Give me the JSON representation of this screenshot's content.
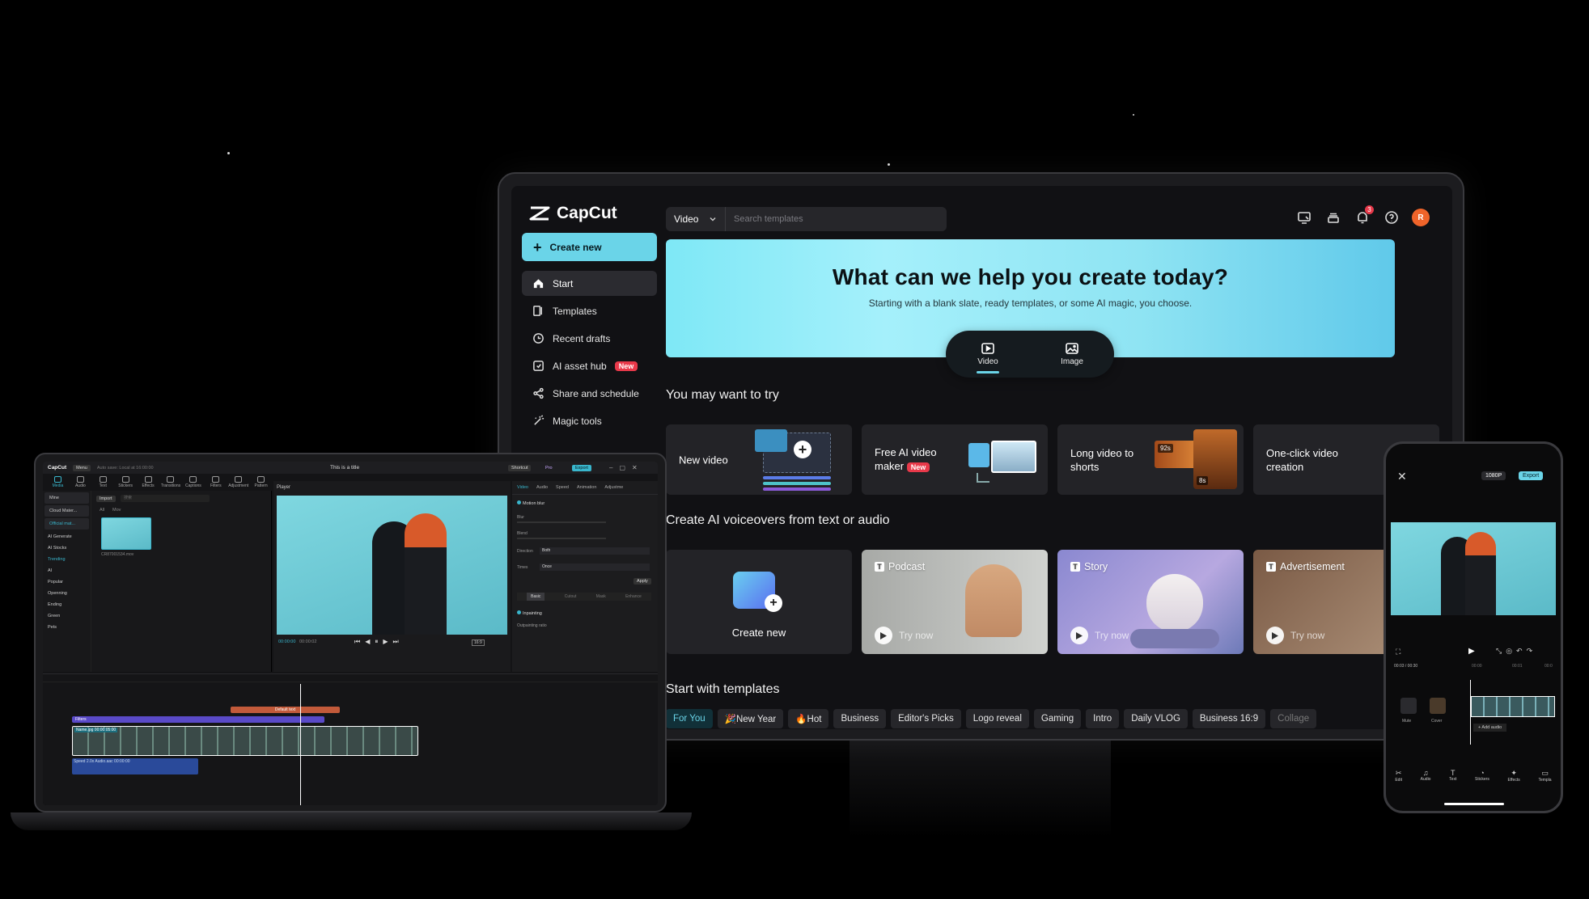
{
  "app": {
    "name": "CapCut",
    "create_new": "Create new"
  },
  "sidebar": {
    "items": [
      {
        "label": "Start",
        "icon": "home-icon",
        "active": true
      },
      {
        "label": "Templates",
        "icon": "templates-icon"
      },
      {
        "label": "Recent drafts",
        "icon": "clock-icon"
      },
      {
        "label": "AI asset hub",
        "icon": "ai-asset-icon",
        "badge": "New"
      },
      {
        "label": "Share and schedule",
        "icon": "share-icon"
      },
      {
        "label": "Magic tools",
        "icon": "magic-wand-icon"
      }
    ]
  },
  "search": {
    "type": "Video",
    "placeholder": "Search templates"
  },
  "header": {
    "notification_count": "3",
    "avatar_initial": "R"
  },
  "hero": {
    "title": "What can we help you create today?",
    "subtitle": "Starting with a blank slate, ready templates, or some AI magic, you choose.",
    "tabs": [
      {
        "label": "Video",
        "icon": "video-icon",
        "active": true
      },
      {
        "label": "Image",
        "icon": "image-icon"
      }
    ]
  },
  "try_section": {
    "title": "You may want to try",
    "cards": [
      {
        "label": "New video"
      },
      {
        "label": "Free AI video maker",
        "badge": "New"
      },
      {
        "label": "Long video to shorts",
        "tag1": "92s",
        "tag2": "8s"
      },
      {
        "label": "One-click video creation"
      }
    ]
  },
  "voiceover_section": {
    "title": "Create AI voiceovers from text or audio",
    "cards": [
      {
        "label": "Create new"
      },
      {
        "label": "Podcast",
        "action": "Try now"
      },
      {
        "label": "Story",
        "action": "Try now"
      },
      {
        "label": "Advertisement",
        "action": "Try now"
      }
    ]
  },
  "templates_section": {
    "title": "Start with templates",
    "chips": [
      "For You",
      "🎉New Year",
      "🔥Hot",
      "Business",
      "Editor's Picks",
      "Logo reveal",
      "Gaming",
      "Intro",
      "Daily VLOG",
      "Business 16:9",
      "Collage"
    ]
  },
  "laptop": {
    "logo": "CapCut",
    "menu": "Menu",
    "autosave": "Auto save: Local at 16:00:00",
    "title": "This is a title",
    "shortcut": "Shortcut",
    "pro": "Pro",
    "export": "Export",
    "tools": [
      "Media",
      "Audio",
      "Text",
      "Stickers",
      "Effects",
      "Transitions",
      "Captions",
      "Filters",
      "Adjustment",
      "Pattern"
    ],
    "media_side": [
      "Mine",
      "Cloud Mater...",
      "Official mat...",
      "AI Generate",
      "AI Stocks",
      "Trending",
      "AI",
      "Popular",
      "Openning",
      "Ending",
      "Green",
      "Pets"
    ],
    "import": "Import",
    "search_hint": "搜索",
    "filter_all": "All",
    "filter_mov": "Mov",
    "file_name": "CR87001534.mov",
    "player_label": "Player",
    "time_current": "00:00:00",
    "time_total": "00:00:02",
    "ratio": "16:9",
    "prop_tabs": [
      "Video",
      "Audio",
      "Speed",
      "Animation",
      "Adjustme"
    ],
    "motion_blur": "Motion blur",
    "blur": "Blur",
    "blend": "Blend",
    "direction": "Direction",
    "direction_value": "Both",
    "times": "Times",
    "times_value": "Once",
    "apply": "Apply",
    "sub_tabs": [
      "Basic",
      "Cutout",
      "Mask",
      "Enhance"
    ],
    "inpainting": "Inpainting",
    "outpainting": "Outpainting ratio",
    "clip_text": "Default text",
    "clip_filters": "Filters",
    "clip_video": "Name.jpg   00:00:05:00",
    "clip_audio": "Speed 2.0x   Audio.aac   00:00:00"
  },
  "phone": {
    "resolution": "1080P",
    "export": "Export",
    "time": "00:03 / 00:30",
    "ruler_a": "00:00",
    "ruler_b": "00:01",
    "ruler_c": "00:0",
    "mute": "Mute",
    "cover": "Cover",
    "add_audio": "+ Add audio",
    "tools": [
      "Edit",
      "Audio",
      "Text",
      "Stickers",
      "Effects",
      "Templa"
    ]
  }
}
